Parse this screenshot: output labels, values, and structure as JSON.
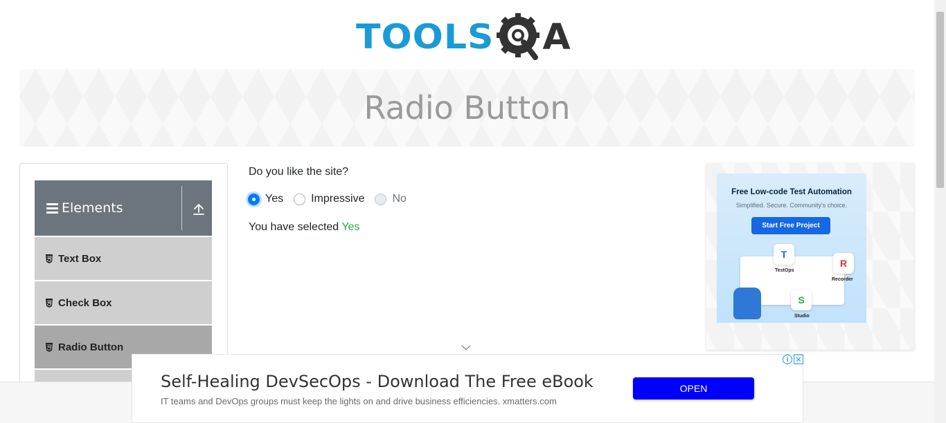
{
  "header": {
    "logo_text_primary": "TOOLS",
    "logo_text_secondary": "A"
  },
  "banner": {
    "title": "Radio Button"
  },
  "sidebar": {
    "group_title": "Elements",
    "items": [
      {
        "label": "Text Box"
      },
      {
        "label": "Check Box"
      },
      {
        "label": "Radio Button"
      }
    ]
  },
  "main": {
    "question": "Do you like the site?",
    "options": [
      {
        "label": "Yes",
        "state": "checked"
      },
      {
        "label": "Impressive",
        "state": "unchecked"
      },
      {
        "label": "No",
        "state": "disabled"
      }
    ],
    "result_prefix": "You have selected ",
    "result_value": "Yes"
  },
  "ad_right": {
    "headline": "Free Low-code Test Automation",
    "subline": "Simplified. Secure. Community's choice.",
    "cta": "Start Free Project",
    "labels": {
      "testops": "TestOps",
      "recorder": "Recorder",
      "studio": "Studio"
    }
  },
  "ad_bottom": {
    "headline": "Self-Healing DevSecOps - Download The Free eBook",
    "sub": "IT teams and DevOps groups must keep the lights on and drive business efficiencies. xmatters.com",
    "cta": "OPEN"
  },
  "colors": {
    "brand_blue": "#1a9ad7",
    "accent": "#007bff",
    "success": "#28a745",
    "sidebar_header": "#6c757d"
  },
  "icons": [
    "gear-magnifier-icon",
    "hamburger-icon",
    "collapse-up-icon",
    "html5-icon",
    "chevron-down-icon",
    "info-icon",
    "close-icon"
  ]
}
